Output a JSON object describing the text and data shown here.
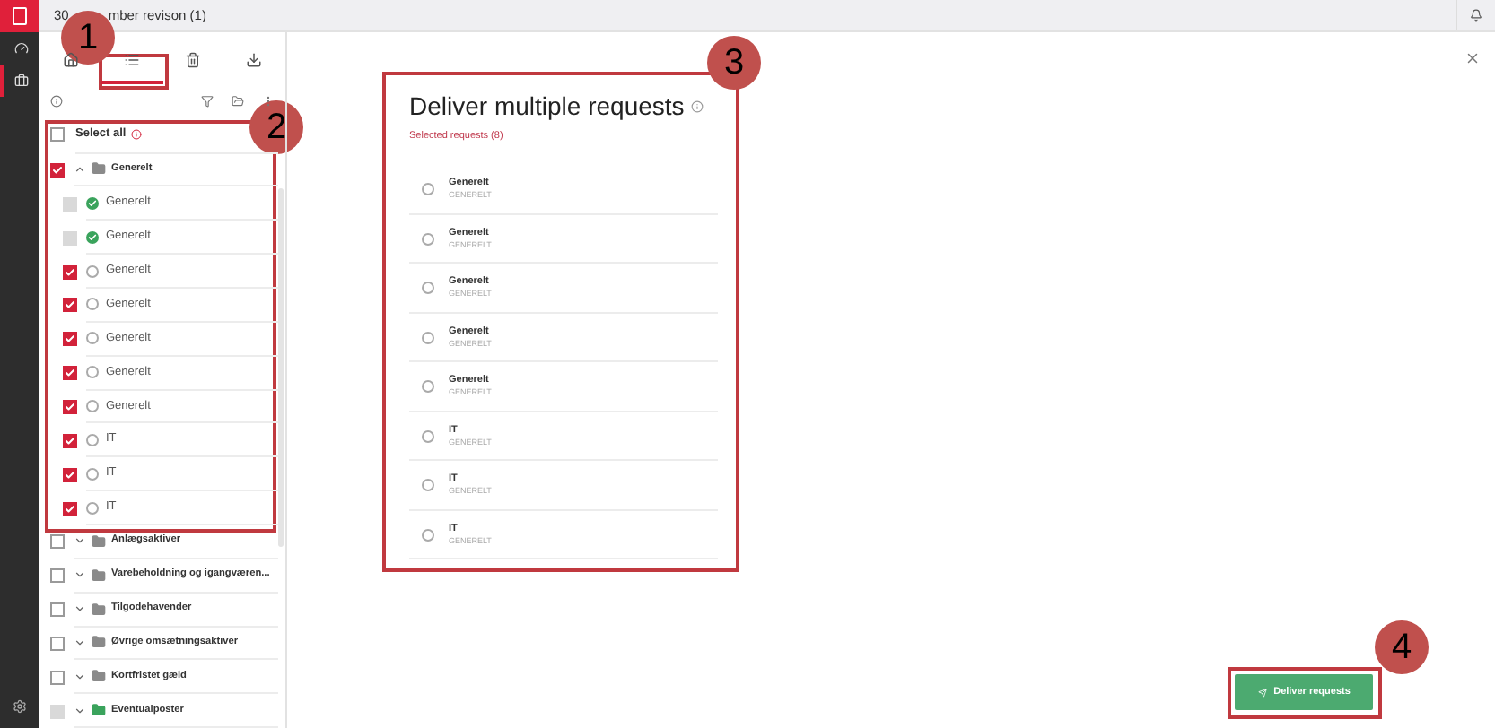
{
  "window": {
    "title_parts": [
      "30",
      "mber revison (1)"
    ]
  },
  "rail": {
    "items": [
      {
        "selected": false
      },
      {
        "selected": true
      }
    ]
  },
  "sidebar": {
    "tabs": [
      {
        "selected": false
      },
      {
        "selected": true
      },
      {
        "selected": false
      },
      {
        "selected": false
      }
    ],
    "select_all": {
      "label": "Select all",
      "checked": false
    },
    "tree": [
      {
        "kind": "folder",
        "label": "Generelt",
        "checked": true,
        "disabled": false,
        "expanded": true,
        "color": "#8a8a8a"
      },
      {
        "kind": "item",
        "label": "Generelt",
        "checked": false,
        "disabled": true,
        "done": true
      },
      {
        "kind": "item",
        "label": "Generelt",
        "checked": false,
        "disabled": true,
        "done": true
      },
      {
        "kind": "item",
        "label": "Generelt",
        "checked": true,
        "disabled": false,
        "done": false
      },
      {
        "kind": "item",
        "label": "Generelt",
        "checked": true,
        "disabled": false,
        "done": false
      },
      {
        "kind": "item",
        "label": "Generelt",
        "checked": true,
        "disabled": false,
        "done": false
      },
      {
        "kind": "item",
        "label": "Generelt",
        "checked": true,
        "disabled": false,
        "done": false
      },
      {
        "kind": "item",
        "label": "Generelt",
        "checked": true,
        "disabled": false,
        "done": false
      },
      {
        "kind": "item",
        "label": "IT",
        "checked": true,
        "disabled": false,
        "done": false
      },
      {
        "kind": "item",
        "label": "IT",
        "checked": true,
        "disabled": false,
        "done": false
      },
      {
        "kind": "item",
        "label": "IT",
        "checked": true,
        "disabled": false,
        "done": false
      },
      {
        "kind": "folder",
        "label": "Anlægsaktiver",
        "checked": false,
        "disabled": false,
        "expanded": false,
        "color": "#8a8a8a"
      },
      {
        "kind": "folder",
        "label": "Varebeholdning og igangværen...",
        "checked": false,
        "disabled": false,
        "expanded": false,
        "color": "#8a8a8a"
      },
      {
        "kind": "folder",
        "label": "Tilgodehavender",
        "checked": false,
        "disabled": false,
        "expanded": false,
        "color": "#8a8a8a"
      },
      {
        "kind": "folder",
        "label": "Øvrige omsætningsaktiver",
        "checked": false,
        "disabled": false,
        "expanded": false,
        "color": "#8a8a8a"
      },
      {
        "kind": "folder",
        "label": "Kortfristet gæld",
        "checked": false,
        "disabled": false,
        "expanded": false,
        "color": "#8a8a8a"
      },
      {
        "kind": "folder",
        "label": "Eventualposter",
        "checked": false,
        "disabled": true,
        "expanded": false,
        "color": "#3aa35c"
      }
    ]
  },
  "dialog": {
    "title": "Deliver multiple requests",
    "subtitle": "Selected requests (8)",
    "requests": [
      {
        "name": "Generelt",
        "code": "GENERELT",
        "selected": false
      },
      {
        "name": "Generelt",
        "code": "GENERELT",
        "selected": false
      },
      {
        "name": "Generelt",
        "code": "GENERELT",
        "selected": false
      },
      {
        "name": "Generelt",
        "code": "GENERELT",
        "selected": false
      },
      {
        "name": "Generelt",
        "code": "GENERELT",
        "selected": false
      },
      {
        "name": "IT",
        "code": "GENERELT",
        "selected": false
      },
      {
        "name": "IT",
        "code": "GENERELT",
        "selected": false
      },
      {
        "name": "IT",
        "code": "GENERELT",
        "selected": false
      }
    ],
    "button": "Deliver requests"
  },
  "callouts": [
    "1",
    "2",
    "3",
    "4"
  ]
}
